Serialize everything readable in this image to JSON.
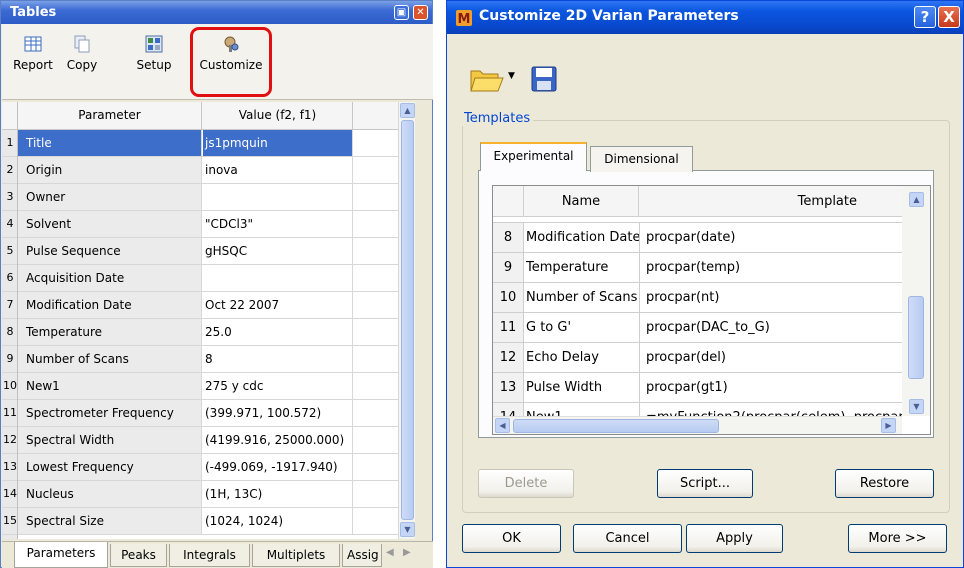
{
  "tables_panel": {
    "title": "Tables",
    "toolbar": {
      "report": "Report",
      "copy": "Copy",
      "setup": "Setup",
      "customize": "Customize"
    },
    "columns": [
      "Parameter",
      "Value (f2, f1)"
    ],
    "rows": [
      {
        "num": "1",
        "param": "Title",
        "value": "js1pmquin"
      },
      {
        "num": "2",
        "param": "Origin",
        "value": "inova"
      },
      {
        "num": "3",
        "param": "Owner",
        "value": ""
      },
      {
        "num": "4",
        "param": "Solvent",
        "value": "\"CDCl3\""
      },
      {
        "num": "5",
        "param": "Pulse Sequence",
        "value": "gHSQC"
      },
      {
        "num": "6",
        "param": "Acquisition Date",
        "value": ""
      },
      {
        "num": "7",
        "param": "Modification Date",
        "value": "Oct 22 2007"
      },
      {
        "num": "8",
        "param": "Temperature",
        "value": "25.0"
      },
      {
        "num": "9",
        "param": "Number of Scans",
        "value": "8"
      },
      {
        "num": "10",
        "param": "New1",
        "value": "275 y cdc"
      },
      {
        "num": "11",
        "param": "Spectrometer Frequency",
        "value": "(399.971, 100.572)"
      },
      {
        "num": "12",
        "param": "Spectral Width",
        "value": "(4199.916, 25000.000)"
      },
      {
        "num": "13",
        "param": "Lowest Frequency",
        "value": "(-499.069, -1917.940)"
      },
      {
        "num": "14",
        "param": "Nucleus",
        "value": "(1H, 13C)"
      },
      {
        "num": "15",
        "param": "Spectral Size",
        "value": "(1024, 1024)"
      }
    ],
    "tabs": [
      "Parameters",
      "Peaks",
      "Integrals",
      "Multiplets",
      "Assig"
    ]
  },
  "customize_dialog": {
    "title": "Customize 2D Varian Parameters",
    "help_label": "?",
    "close_label": "X",
    "group_label": "Templates",
    "tabs": [
      "Experimental",
      "Dimensional"
    ],
    "columns": [
      "Name",
      "Template"
    ],
    "rows": [
      {
        "num": "8",
        "name": "Modification Date",
        "template": "procpar(date)"
      },
      {
        "num": "9",
        "name": "Temperature",
        "template": "procpar(temp)"
      },
      {
        "num": "10",
        "name": "Number of Scans",
        "template": "procpar(nt)"
      },
      {
        "num": "11",
        "name": "G to G'",
        "template": "procpar(DAC_to_G)"
      },
      {
        "num": "12",
        "name": "Echo Delay",
        "template": "procpar(del)"
      },
      {
        "num": "13",
        "name": "Pulse Width",
        "template": "procpar(gt1)"
      },
      {
        "num": "14",
        "name": "New1",
        "template": "=myFunction2(procpar(celem), procpar"
      }
    ],
    "buttons": {
      "delete": "Delete",
      "script": "Script...",
      "restore": "Restore",
      "ok": "OK",
      "cancel": "Cancel",
      "apply": "Apply",
      "more": "More >>"
    }
  },
  "colors": {
    "selection": "#3d6ec9",
    "highlight_box": "#e01010",
    "dialog_title": "#0b57e0",
    "group_label": "#0046d5"
  }
}
